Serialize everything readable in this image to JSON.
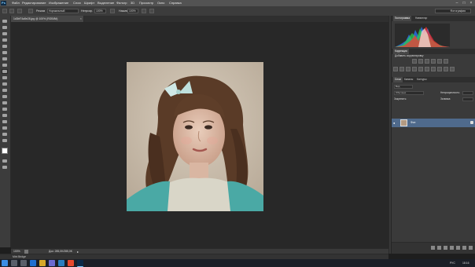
{
  "menubar": {
    "items": [
      "Файл",
      "Редактирование",
      "Изображение",
      "Слои",
      "Шрифт",
      "Выделение",
      "Фильтр",
      "3D",
      "Просмотр",
      "Окно",
      "Справка"
    ]
  },
  "options": {
    "style_label": "Режим",
    "style_value": "Нормальный",
    "opacity_label": "Непрозр.",
    "opacity_value": "100%",
    "flow_label": "Нажим",
    "flow_value": "100%",
    "workspace": "Фотография"
  },
  "document": {
    "tab_title": "1d3bf74a5e28.jpg @ 100% (RGB/8#)",
    "zoom": "100%",
    "doc_info": "Док: 285,0K/285,0K",
    "mini_bridge": "Mini Bridge"
  },
  "panels": {
    "top_tabs": [
      "Гистограмма",
      "Навигатор"
    ],
    "adjust_tab": "Коррекция",
    "adjust_title": "Добавить корректировку",
    "layer_tabs": [
      "Слои",
      "Каналы",
      "Контуры"
    ],
    "kind_label": "Вид",
    "mode_value": "Обычные",
    "opacity_label": "Непрозрачность:",
    "lock_label": "Закрепить:",
    "fill_label": "Заливка:",
    "layer_name": "Фон"
  },
  "taskbar": {
    "lang": "РУС",
    "time": "18:16"
  },
  "colors": {
    "accent": "#4f6a8c",
    "canvas": "#282828",
    "panel": "#3a3a3a"
  }
}
